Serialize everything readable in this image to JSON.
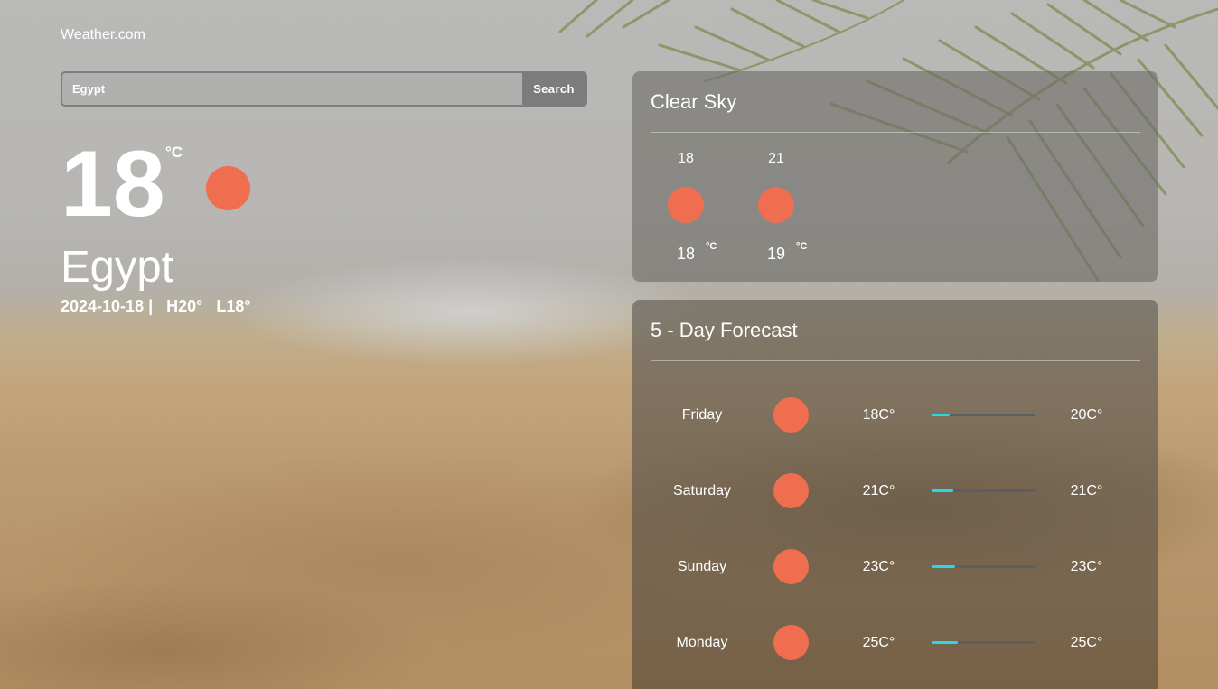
{
  "brand": "Weather.com",
  "search": {
    "value": "Egypt",
    "button_label": "Search"
  },
  "current": {
    "temperature": "18",
    "unit": "°C",
    "icon": "sun-icon",
    "city": "Egypt",
    "date": "2024-10-18 |",
    "high": "H20°",
    "low": "L18°"
  },
  "hourly": {
    "title": "Clear Sky",
    "items": [
      {
        "time": "18",
        "icon": "sun-icon",
        "temp": "18",
        "unit": "°C"
      },
      {
        "time": "21",
        "icon": "sun-icon",
        "temp": "19",
        "unit": "°C"
      }
    ]
  },
  "forecast": {
    "title": "5 - Day Forecast",
    "days": [
      {
        "day": "Friday",
        "icon": "sun-icon",
        "low": "18C°",
        "high": "20C°",
        "range_fraction": 0.17
      },
      {
        "day": "Saturday",
        "icon": "sun-icon",
        "low": "21C°",
        "high": "21C°",
        "range_fraction": 0.21
      },
      {
        "day": "Sunday",
        "icon": "sun-icon",
        "low": "23C°",
        "high": "23C°",
        "range_fraction": 0.23
      },
      {
        "day": "Monday",
        "icon": "sun-icon",
        "low": "25C°",
        "high": "25C°",
        "range_fraction": 0.25
      }
    ]
  },
  "colors": {
    "sun": "#ee6e4f",
    "range_fill": "#25d8e3",
    "range_track": "#5b5f63"
  }
}
